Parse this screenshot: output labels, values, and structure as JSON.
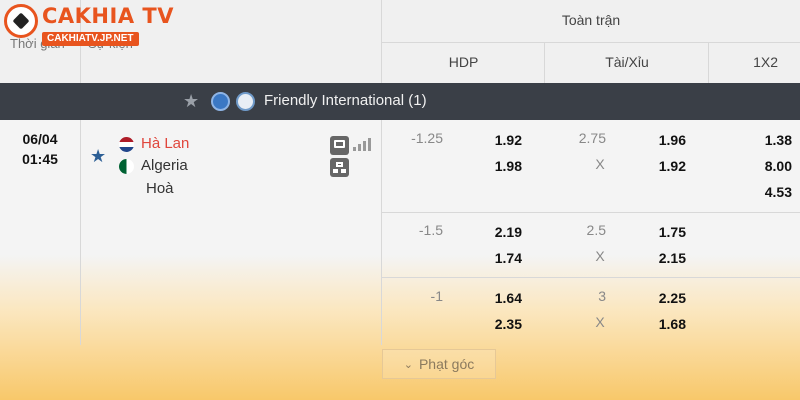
{
  "logo": {
    "main": "CAKHIA TV",
    "sub": "CAKHIATV.JP.NET"
  },
  "header": {
    "col_time": "Thời gian",
    "col_match": "Sự kiện",
    "group": "Toàn trận",
    "hdp": "HDP",
    "taixiu": "Tài/Xỉu",
    "x12": "1X2"
  },
  "league": {
    "name": "Friendly International (1)",
    "star_icon": "star-icon"
  },
  "match": {
    "date": "06/04",
    "time": "01:45",
    "home": "Hà Lan",
    "away": "Algeria",
    "draw": "Hoà",
    "home_color": "#e0463c"
  },
  "odds": [
    {
      "hdp_line": "-1.25",
      "hdp_home": "1.92",
      "hdp_away": "1.98",
      "ou_line": "2.75",
      "ou_x": "X",
      "ou_over": "1.96",
      "ou_under": "1.92",
      "x12": [
        "1.38",
        "8.00",
        "4.53"
      ]
    },
    {
      "hdp_line": "-1.5",
      "hdp_home": "2.19",
      "hdp_away": "1.74",
      "ou_line": "2.5",
      "ou_x": "X",
      "ou_over": "1.75",
      "ou_under": "2.15"
    },
    {
      "hdp_line": "-1",
      "hdp_home": "1.64",
      "hdp_away": "2.35",
      "ou_line": "3",
      "ou_x": "X",
      "ou_over": "2.25",
      "ou_under": "1.68"
    }
  ],
  "corner_button": "Phạt góc"
}
